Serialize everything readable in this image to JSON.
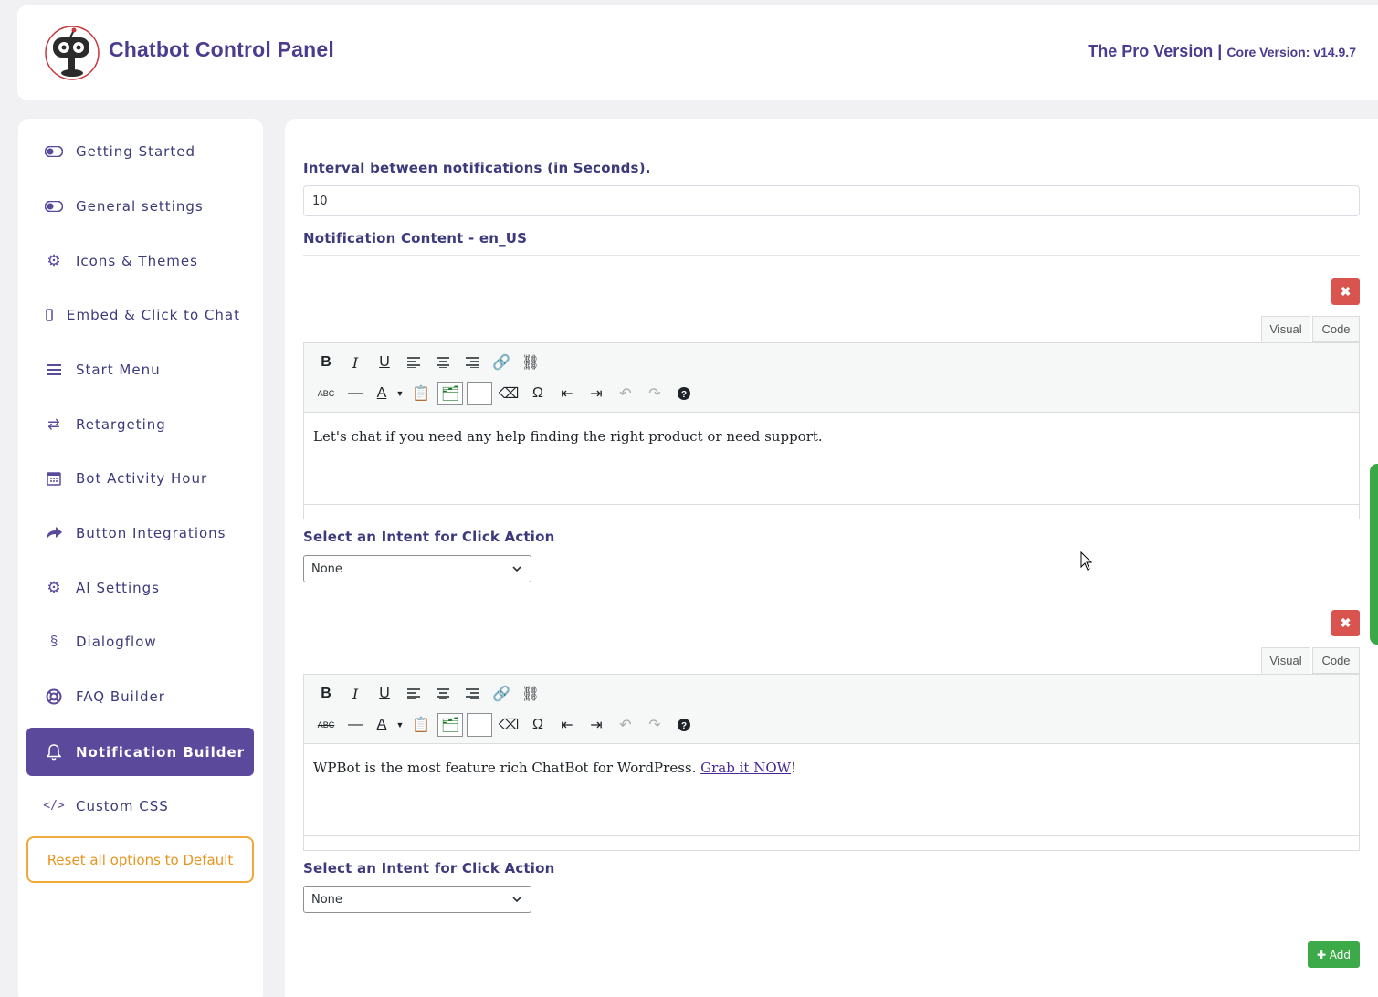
{
  "header": {
    "title": "Chatbot Control Panel",
    "pro_version": "The Pro Version |",
    "core_version": "Core Version: v14.9.7"
  },
  "sidebar": {
    "items": [
      {
        "label": "Getting Started",
        "icon": "toggle-icon"
      },
      {
        "label": "General settings",
        "icon": "toggle-icon"
      },
      {
        "label": "Icons & Themes",
        "icon": "gear-icon"
      },
      {
        "label": "Embed & Click to Chat",
        "icon": "mobile-icon"
      },
      {
        "label": "Start Menu",
        "icon": "bars-icon"
      },
      {
        "label": "Retargeting",
        "icon": "retweet-icon"
      },
      {
        "label": "Bot Activity Hour",
        "icon": "calendar-icon"
      },
      {
        "label": "Button Integrations",
        "icon": "share-icon"
      },
      {
        "label": "AI Settings",
        "icon": "gear-icon"
      },
      {
        "label": "Dialogflow",
        "icon": "dialogflow-icon"
      },
      {
        "label": "FAQ Builder",
        "icon": "life-ring-icon"
      },
      {
        "label": "Notification Builder",
        "icon": "bell-icon",
        "active": true
      },
      {
        "label": "Custom CSS",
        "icon": "code-icon"
      }
    ],
    "reset_label": "Reset all options to Default"
  },
  "main": {
    "interval_label": "Interval between notifications (in Seconds).",
    "interval_value": "10",
    "content_heading": "Notification Content - en_US",
    "notifications": [
      {
        "delete_label": "✖",
        "tab_visual": "Visual",
        "tab_code": "Code",
        "text": "Let's chat if you need any help finding the right product or need support.",
        "intent_label": "Select an Intent for Click Action",
        "intent_value": "None"
      },
      {
        "delete_label": "✖",
        "tab_visual": "Visual",
        "tab_code": "Code",
        "text": "WPBot is the most feature rich ChatBot for WordPress. ",
        "link_text": "Grab it NOW",
        "text_after": "!",
        "intent_label": "Select an Intent for Click Action",
        "intent_value": "None"
      }
    ],
    "add_label": "✚ Add"
  },
  "toolbar": {
    "row1": [
      "B",
      "I",
      "U"
    ],
    "colors": {
      "accent": "#5b4a9c",
      "danger": "#d9534f",
      "success": "#3daa4a",
      "reset": "#f0a93a"
    }
  }
}
